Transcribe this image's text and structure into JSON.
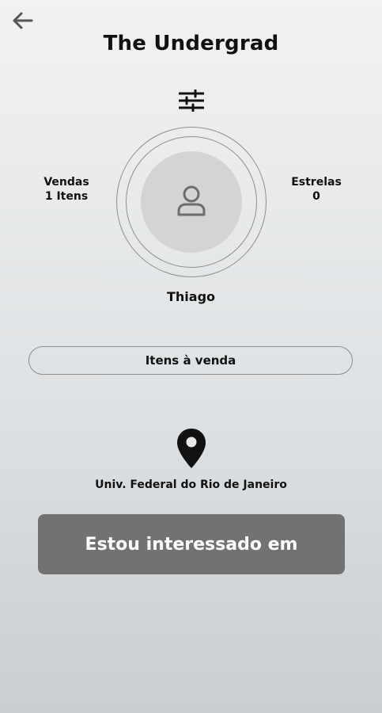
{
  "header": {
    "title": "The Undergrad"
  },
  "profile": {
    "name": "Thiago",
    "stats": {
      "sales_label": "Vendas",
      "sales_value": "1 Itens",
      "stars_label": "Estrelas",
      "stars_value": "0"
    }
  },
  "actions": {
    "items_for_sale": "Itens à venda",
    "interested": "Estou interessado em"
  },
  "location": {
    "text": "Univ. Federal do Rio de Janeiro"
  },
  "icons": {
    "back": "arrow-left-icon",
    "filters": "sliders-icon",
    "avatar": "user-icon",
    "location": "map-pin-icon"
  },
  "colors": {
    "cta_background": "#727272",
    "ring": "#8e8e8e",
    "avatar_background": "#d4d4d4",
    "text": "#111111"
  }
}
